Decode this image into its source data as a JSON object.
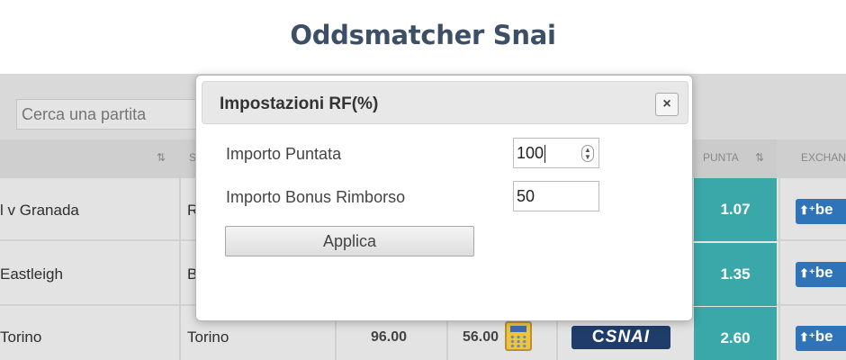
{
  "page": {
    "title": "Oddsmatcher Snai"
  },
  "search": {
    "placeholder": "Cerca una partita"
  },
  "table": {
    "headers": {
      "squadra_initial": "S",
      "punta": "PUNTA",
      "exchange": "EXCHAN"
    },
    "rows": [
      {
        "evento": "l v Granada",
        "squadra": "R",
        "punta": "1.07",
        "exchange": "be"
      },
      {
        "evento": "Eastleigh",
        "squadra": "B",
        "punta": "1.35",
        "exchange": "be"
      },
      {
        "evento": "Torino",
        "squadra": "Torino",
        "quota_a": "96.00",
        "quota_b": "56.00",
        "bookmaker": "SNAI",
        "punta": "2.60",
        "exchange": "be"
      }
    ]
  },
  "modal": {
    "title": "Impostazioni RF(%)",
    "close_icon": "×",
    "fields": [
      {
        "label": "Importo Puntata",
        "value": "100"
      },
      {
        "label": "Importo Bonus Rimborso",
        "value": "50"
      }
    ],
    "apply_label": "Applica"
  },
  "icons": {
    "sort": "⇅",
    "spinner": "⌃⌄"
  },
  "colors": {
    "title": "#3d4f66",
    "punta": "#3aa8a8",
    "exchange": "#2f73b8",
    "snai": "#1f3c6b"
  }
}
